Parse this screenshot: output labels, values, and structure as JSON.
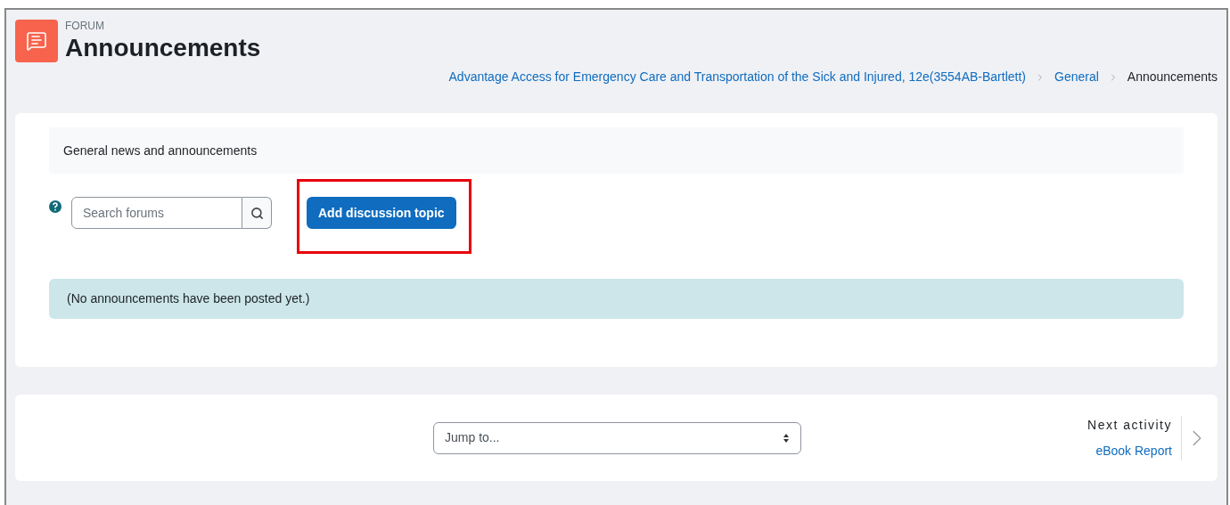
{
  "header": {
    "pretitle": "FORUM",
    "title": "Announcements"
  },
  "breadcrumbs": [
    {
      "label": "Advantage Access for Emergency Care and Transportation of the Sick and Injured, 12e(3554AB-Bartlett)",
      "current": false
    },
    {
      "label": "General",
      "current": false
    },
    {
      "label": "Announcements",
      "current": true
    }
  ],
  "intro": "General news and announcements",
  "search": {
    "placeholder": "Search forums"
  },
  "add_button": {
    "label": "Add discussion topic",
    "highlighted": true
  },
  "notice": "(No announcements have been posted yet.)",
  "footer": {
    "jump_placeholder": "Jump to...",
    "next_label": "Next activity",
    "next_link": "eBook Report"
  }
}
